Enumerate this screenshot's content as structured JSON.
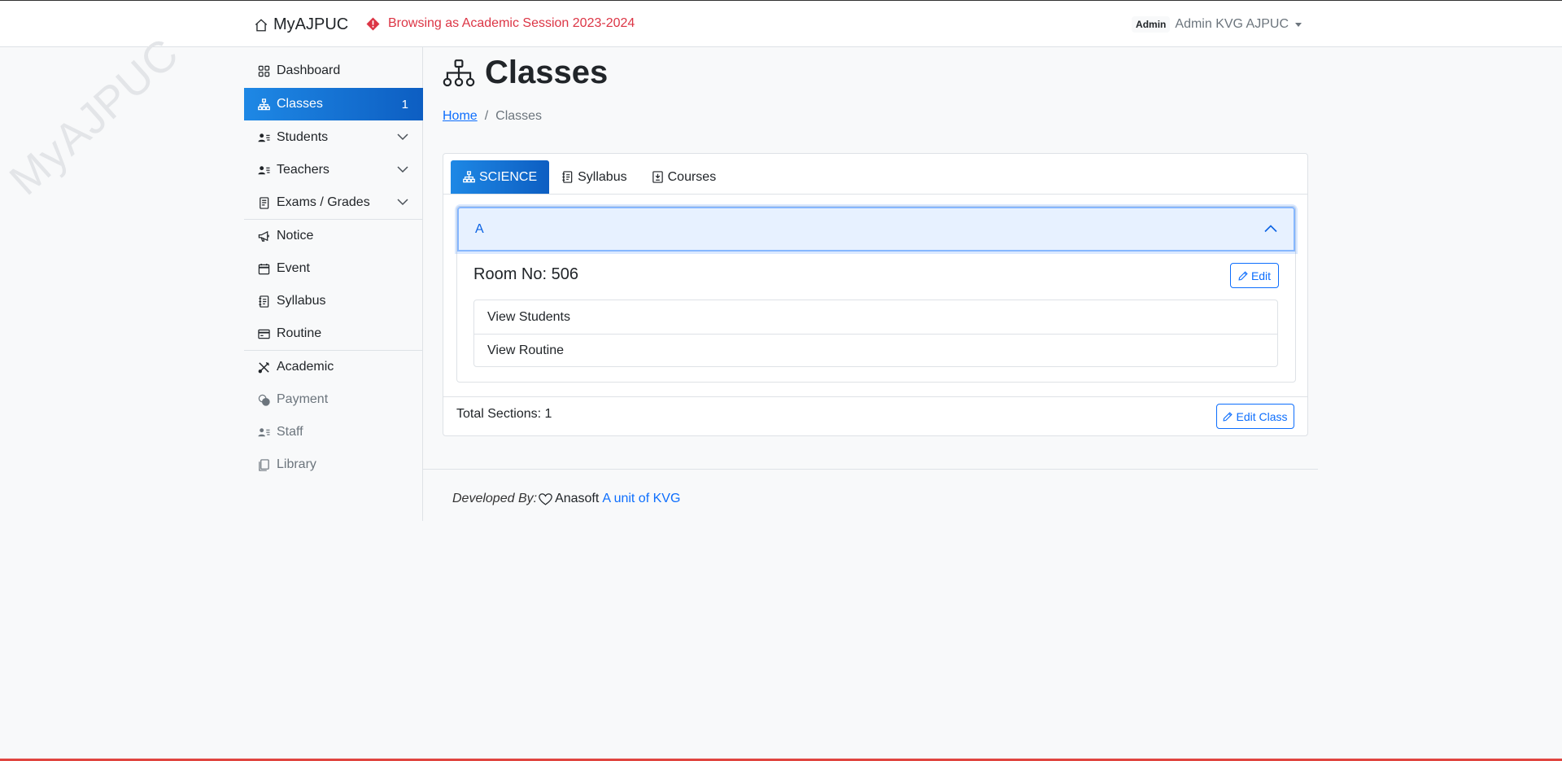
{
  "header": {
    "brand": "MyAJPUC",
    "session_notice": "Browsing as Academic Session 2023-2024",
    "role_badge": "Admin",
    "user_name": "Admin KVG AJPUC"
  },
  "watermark": "MyAJPUC",
  "sidebar": {
    "items": [
      {
        "label": "Dashboard",
        "icon": "grid-icon"
      },
      {
        "label": "Classes",
        "icon": "hierarchy-icon",
        "count": "1",
        "active": true
      },
      {
        "label": "Students",
        "icon": "person-lines-icon",
        "expandable": true
      },
      {
        "label": "Teachers",
        "icon": "person-lines-icon",
        "expandable": true
      },
      {
        "label": "Exams / Grades",
        "icon": "journal-icon",
        "expandable": true
      },
      {
        "label": "Notice",
        "icon": "megaphone-icon"
      },
      {
        "label": "Event",
        "icon": "calendar-icon"
      },
      {
        "label": "Syllabus",
        "icon": "journal-text-icon"
      },
      {
        "label": "Routine",
        "icon": "card-icon"
      },
      {
        "label": "Academic",
        "icon": "tools-icon"
      },
      {
        "label": "Payment",
        "icon": "coins-icon",
        "muted": true
      },
      {
        "label": "Staff",
        "icon": "person-lines-icon",
        "muted": true
      },
      {
        "label": "Library",
        "icon": "journals-icon",
        "muted": true
      }
    ]
  },
  "main": {
    "title": "Classes",
    "breadcrumb": {
      "home": "Home",
      "current": "Classes"
    },
    "tabs": [
      {
        "label": "SCIENCE",
        "icon": "hierarchy-icon",
        "active": true
      },
      {
        "label": "Syllabus",
        "icon": "journal-text-icon"
      },
      {
        "label": "Courses",
        "icon": "journal-arrow-icon"
      }
    ],
    "section": {
      "name": "A",
      "room": "Room No: 506",
      "edit_label": "Edit",
      "links": [
        "View Students",
        "View Routine"
      ]
    },
    "total_sections": "Total Sections: 1",
    "edit_class_label": "Edit Class"
  },
  "footer": {
    "developed_by": "Developed By:",
    "company": "Anasoft",
    "unit_link": "A unit of KVG"
  },
  "colors": {
    "accent": "#0d6efd",
    "active_gradient_start": "#1e88e5",
    "active_gradient_end": "#0d5ec2",
    "danger": "#dc3545"
  }
}
